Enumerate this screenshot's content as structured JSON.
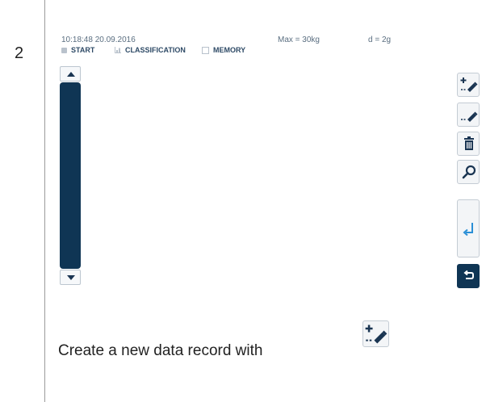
{
  "step": {
    "number": "2"
  },
  "status": {
    "time": "10:18:48",
    "date": "20.09.2016",
    "max": "Max = 30kg",
    "resolution": "d = 2g"
  },
  "breadcrumb": [
    {
      "label": "START",
      "icon": "scale-icon"
    },
    {
      "label": "CLASSIFICATION",
      "icon": "classification-icon"
    },
    {
      "label": "MEMORY",
      "icon": "memory-icon"
    }
  ],
  "scrollbar": {
    "up_icon": "arrow-up-icon",
    "down_icon": "arrow-down-icon"
  },
  "buttons": {
    "add": {
      "icon": "add-record-icon"
    },
    "edit": {
      "icon": "edit-record-icon"
    },
    "delete": {
      "icon": "trash-icon"
    },
    "search": {
      "icon": "search-icon"
    },
    "enter": {
      "icon": "enter-icon"
    },
    "back": {
      "icon": "back-icon"
    }
  },
  "colors": {
    "accent": "#0f3554",
    "enter_arrow": "#2a8fd6",
    "text_muted": "#5a6e80"
  },
  "caption": {
    "text": "Create a new data record with"
  }
}
